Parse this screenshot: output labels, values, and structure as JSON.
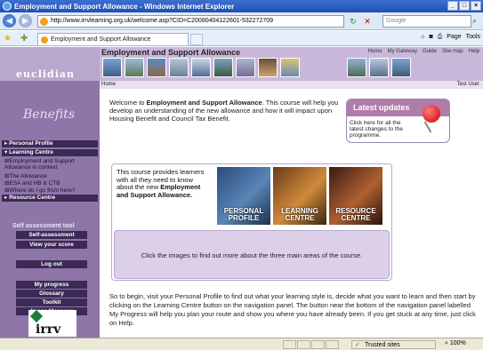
{
  "window": {
    "title": "Employment and Support Allowance - Windows Internet Explorer"
  },
  "address_bar": {
    "url": "http://www.irrvlearning.org.uk/welcome.asp?CID=C20080404122601-532272709",
    "search_placeholder": "Google"
  },
  "tabs": [
    {
      "label": "Employment and Support Allowance"
    }
  ],
  "command_bar": {
    "page_label": "Page",
    "tools_label": "Tools"
  },
  "site": {
    "logo_text": "euclidian",
    "course_title": "Employment and Support Allowance",
    "top_nav": [
      "Home",
      "My Gateway",
      "Guide",
      "Site map",
      "Help"
    ],
    "breadcrumb": "Home",
    "user": "Test User",
    "benefits_label": "Benefits"
  },
  "sidebar": {
    "personal_profile": "Personal Profile",
    "learning_centre": "Learning Centre",
    "learning_items": [
      "Employment and Support Allowance in context",
      "The Allowance",
      "ESA and HB & CTB",
      "Where do I go from here?"
    ],
    "resource_centre": "Resource Centre",
    "self_assessment_title": "Self assessment tool",
    "self_assessment_button": "Self-assessment",
    "view_score_button": "View your score",
    "logout_button": "Log out",
    "progress_button": "My progress",
    "glossary_button": "Glossary",
    "toolkit_button": "Toolkit",
    "image_manager_button": "Image Manager",
    "partner_logo": "irrv"
  },
  "main": {
    "welcome_prefix": "Welcome to ",
    "welcome_bold": "Employment and Support Allowance",
    "welcome_suffix": ". This course will help you develop an understanding of the new allowance and how it will impact upon Housing Benefit and Council Tax Benefit.",
    "updates_title": "Latest updates",
    "updates_body": "Click here for all the latest changes to the programme.",
    "areas_intro": "This course provides learners with all they need to know about the new ",
    "areas_intro_bold": "Employment and Support Allowance.",
    "areas": [
      {
        "label_line1": "PERSONAL",
        "label_line2": "PROFILE"
      },
      {
        "label_line1": "LEARNING",
        "label_line2": "CENTRE"
      },
      {
        "label_line1": "RESOURCE",
        "label_line2": "CENTRE"
      }
    ],
    "areas_caption": "Click the images to find out more about the three main areas of the course.",
    "begin_text": "So to begin, visit your Personal Profile to find out what your learning style is, decide what you want to learn and then start by clicking on the Learning Centre button on the navigation panel. The button near the bottom of the navigation panel labelled My Progress will help you plan your route and show you where you have already been. If you get stuck at any time, just click on Help."
  },
  "status_bar": {
    "zone": "Trusted sites",
    "zoom": "100%"
  },
  "colors": {
    "sidebar_bg": "#8e76a9",
    "menu_dark": "#3b2a55",
    "banner_bg": "#c9b8da",
    "updates_head": "#b07ca8"
  }
}
